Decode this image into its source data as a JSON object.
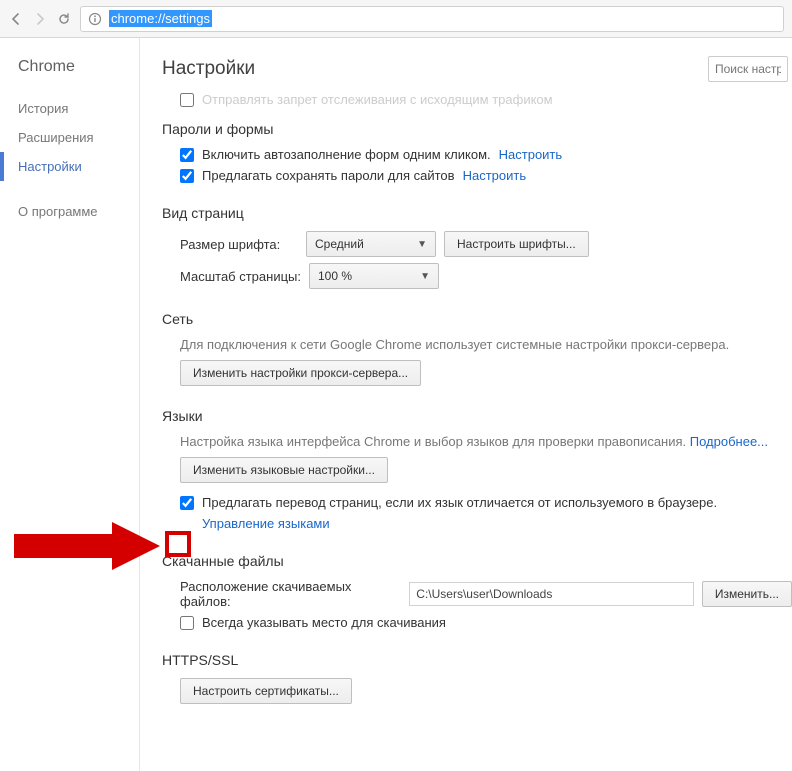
{
  "toolbar": {
    "url": "chrome://settings"
  },
  "sidebar": {
    "brand": "Chrome",
    "items": [
      "История",
      "Расширения",
      "Настройки"
    ],
    "footer": "О программе",
    "active_index": 2
  },
  "header": {
    "title": "Настройки",
    "search_placeholder": "Поиск настро"
  },
  "cutoff": {
    "label": "Отправлять запрет отслеживания с исходящим трафиком"
  },
  "passwords": {
    "heading": "Пароли и формы",
    "autofill": "Включить автозаполнение форм одним кликом.",
    "autofill_link": "Настроить",
    "offer_save": "Предлагать сохранять пароли для сайтов",
    "offer_save_link": "Настроить"
  },
  "appearance": {
    "heading": "Вид страниц",
    "font_size_label": "Размер шрифта:",
    "font_size_value": "Средний",
    "fonts_button": "Настроить шрифты...",
    "zoom_label": "Масштаб страницы:",
    "zoom_value": "100 %"
  },
  "network": {
    "heading": "Сеть",
    "descr": "Для подключения к сети Google Chrome использует системные настройки прокси-сервера.",
    "button": "Изменить настройки прокси-сервера..."
  },
  "languages": {
    "heading": "Языки",
    "descr_a": "Настройка языка интерфейса Chrome и выбор языков для проверки правописания.",
    "descr_link": "Подробнее...",
    "langs_button": "Изменить языковые настройки...",
    "translate_label": "Предлагать перевод страниц, если их язык отличается от используемого в браузере.",
    "manage_link": "Управление языками"
  },
  "downloads": {
    "heading": "Скачанные файлы",
    "path_label": "Расположение скачиваемых файлов:",
    "path_value": "C:\\Users\\user\\Downloads",
    "change_button": "Изменить...",
    "ask_label": "Всегда указывать место для скачивания"
  },
  "https": {
    "heading": "HTTPS/SSL",
    "button": "Настроить сертификаты..."
  }
}
